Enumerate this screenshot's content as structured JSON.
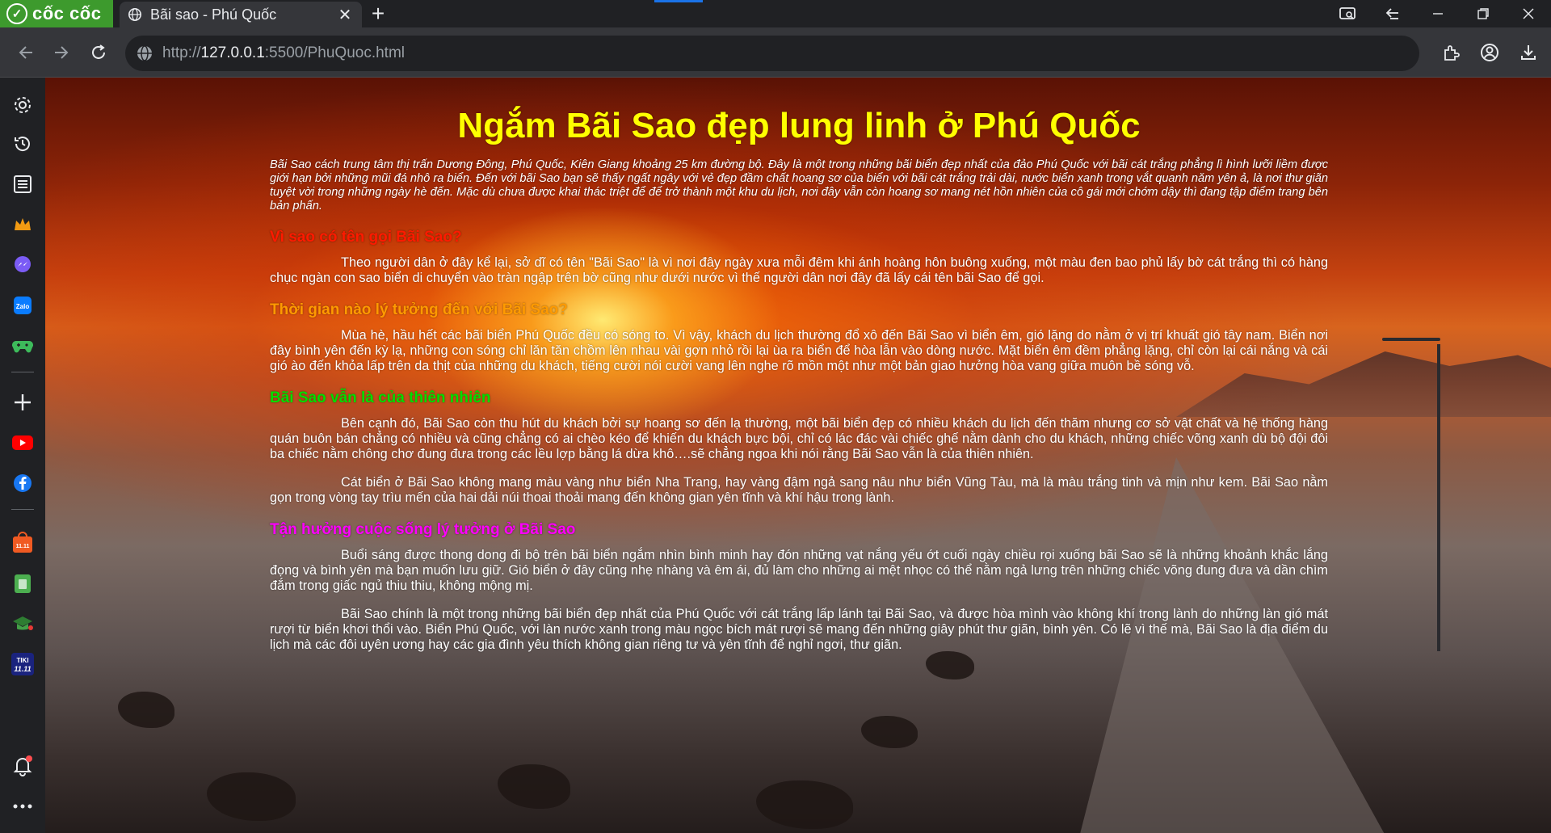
{
  "browser": {
    "brand": "cốc cốc",
    "tab_title": "Bãi sao - Phú Quốc",
    "url_prefix": "http://",
    "url_host": "127.0.0.1",
    "url_rest": ":5500/PhuQuoc.html"
  },
  "icons": {
    "titlebar": [
      "screen-capture-icon",
      "back-arrows-icon",
      "minimize-icon",
      "restore-icon",
      "close-icon"
    ],
    "toolbar": [
      "back-icon",
      "forward-icon",
      "reload-icon",
      "site-info-icon",
      "extensions-icon",
      "profile-icon",
      "download-icon"
    ],
    "sidebar": [
      "settings-icon",
      "history-icon",
      "reading-list-icon",
      "crown-icon",
      "messenger-icon",
      "zalo-icon",
      "game-icon",
      "add-icon",
      "youtube-icon",
      "facebook-icon",
      "shop-icon",
      "voucher-icon",
      "education-icon",
      "tiki-icon",
      "notification-icon",
      "more-icon"
    ]
  },
  "colors": {
    "title": "#ffff00",
    "heading_1": "#ff1a00",
    "heading_2": "#ff9a00",
    "heading_3": "#00dd00",
    "heading_4": "#ff00ff",
    "brand_green": "#3d9a2d"
  },
  "article": {
    "title": "Ngắm Bãi Sao đẹp lung linh ở Phú Quốc",
    "intro": "Bãi Sao cách trung tâm thị trấn Dương Đông, Phú Quốc, Kiên Giang khoảng 25 km đường bộ. Đây là một trong những bãi biển đẹp nhất của đảo Phú Quốc với bãi cát trắng phẳng lì hình lưỡi liềm được giới hạn bởi những mũi đá nhô ra biển. Đến với bãi Sao bạn sẽ thấy ngất ngây với vẻ đẹp đầm chất hoang sơ của biển với bãi cát trắng trải dài, nước biển xanh trong vắt quanh năm yên ả, là nơi thư giãn tuyệt vời trong những ngày hè đến. Mặc dù chưa được khai thác triệt để để trở thành một khu du lịch, nơi đây vẫn còn hoang sơ mang nét hồn nhiên của cô gái mới chớm dậy thì đang tập điểm trang bên bản phấn.",
    "section1_heading": "Vì sao có tên gọi Bãi Sao?",
    "section1_p1": "Theo người dân ở đây kể lại, sở dĩ có tên \"Bãi Sao\" là vì nơi đây ngày xưa mỗi đêm khi ánh hoàng hôn buông xuống, một màu đen bao phủ lấy bờ cát trắng thì có hàng chục ngàn con sao biển di chuyển vào tràn ngập trên bờ cũng như dưới nước vì thế người dân nơi đây đã lấy cái tên bãi Sao để gọi.",
    "section2_heading": "Thời gian nào lý tưởng đến với Bãi Sao?",
    "section2_p1": "Mùa hè, hầu hết các bãi biển Phú Quốc đều có sóng to. Vì vậy, khách du lịch thường đổ xô đến Bãi Sao vì biển êm, gió lặng do nằm ở vị trí khuất gió tây nam. Biển nơi đây bình yên đến kỳ lạ, những con sóng chỉ lăn tăn chồm lên nhau vài gợn nhỏ rồi lại ùa ra biển để hòa lẫn vào dòng nước. Mặt biển êm đềm phẳng lặng, chỉ còn lại cái nắng và cái gió ào đến khỏa lấp trên da thịt của những du khách, tiếng cười nói cười vang lên nghe rõ mồn một như một bản giao hưởng hòa vang giữa muôn bề sóng vỗ.",
    "section3_heading": "Bãi Sao vẫn là của thiên nhiên",
    "section3_p1": "Bên cạnh đó, Bãi Sao còn thu hút du khách bởi sự hoang sơ đến lạ thường, một bãi biển đẹp có nhiều khách du lịch đến thăm nhưng cơ sở vật chất và hệ thống hàng quán buôn bán chẳng có nhiều và cũng chẳng có ai chèo kéo để khiến du khách bực bội, chỉ có lác đác vài chiếc ghế nằm dành cho du khách, những chiếc võng xanh dù bộ đội đôi ba chiếc nằm chông chơ đung đưa trong các lều lợp bằng lá dừa khô….sẽ chẳng ngoa khi nói rằng Bãi Sao vẫn là của thiên nhiên.",
    "section3_p2": "Cát biển ở Bãi Sao không mang màu vàng như biển Nha Trang, hay vàng đậm ngả sang nâu như biển Vũng Tàu, mà là màu trắng tinh và mịn như kem. Bãi Sao nằm gọn trong vòng tay trìu mến của hai dải núi thoai thoải mang đến không gian yên tĩnh và khí hậu trong lành.",
    "section4_heading": "Tận hưởng cuộc sống lý tưởng ở Bãi Sao",
    "section4_p1": "Buổi sáng được thong dong đi bộ trên bãi biển ngắm nhìn bình minh hay đón những vạt nắng yếu ớt cuối ngày chiều rọi xuống bãi Sao sẽ là những khoảnh khắc lắng đọng và bình yên mà bạn muốn lưu giữ. Gió biển ở đây cũng nhẹ nhàng và êm ái, đủ làm cho những ai mệt nhọc có thể nằm ngả lưng trên những chiếc võng đung đưa và dần chìm đắm trong giấc ngủ thiu thiu, không mộng mị.",
    "section4_p2": "Bãi Sao chính là một trong những bãi biển đẹp nhất của Phú Quốc với cát trắng lấp lánh tại Bãi Sao, và được hòa mình vào không khí trong lành do những làn gió mát rượi từ biển khơi thổi vào. Biển Phú Quốc, với làn nước xanh trong màu ngọc bích mát rượi sẽ mang đến những giây phút thư giãn, bình yên. Có lẽ vì thế mà, Bãi Sao là địa điểm du lịch mà các đôi uyên ương hay các gia đình yêu thích không gian riêng tư và yên tĩnh để nghỉ ngơi, thư giãn."
  }
}
